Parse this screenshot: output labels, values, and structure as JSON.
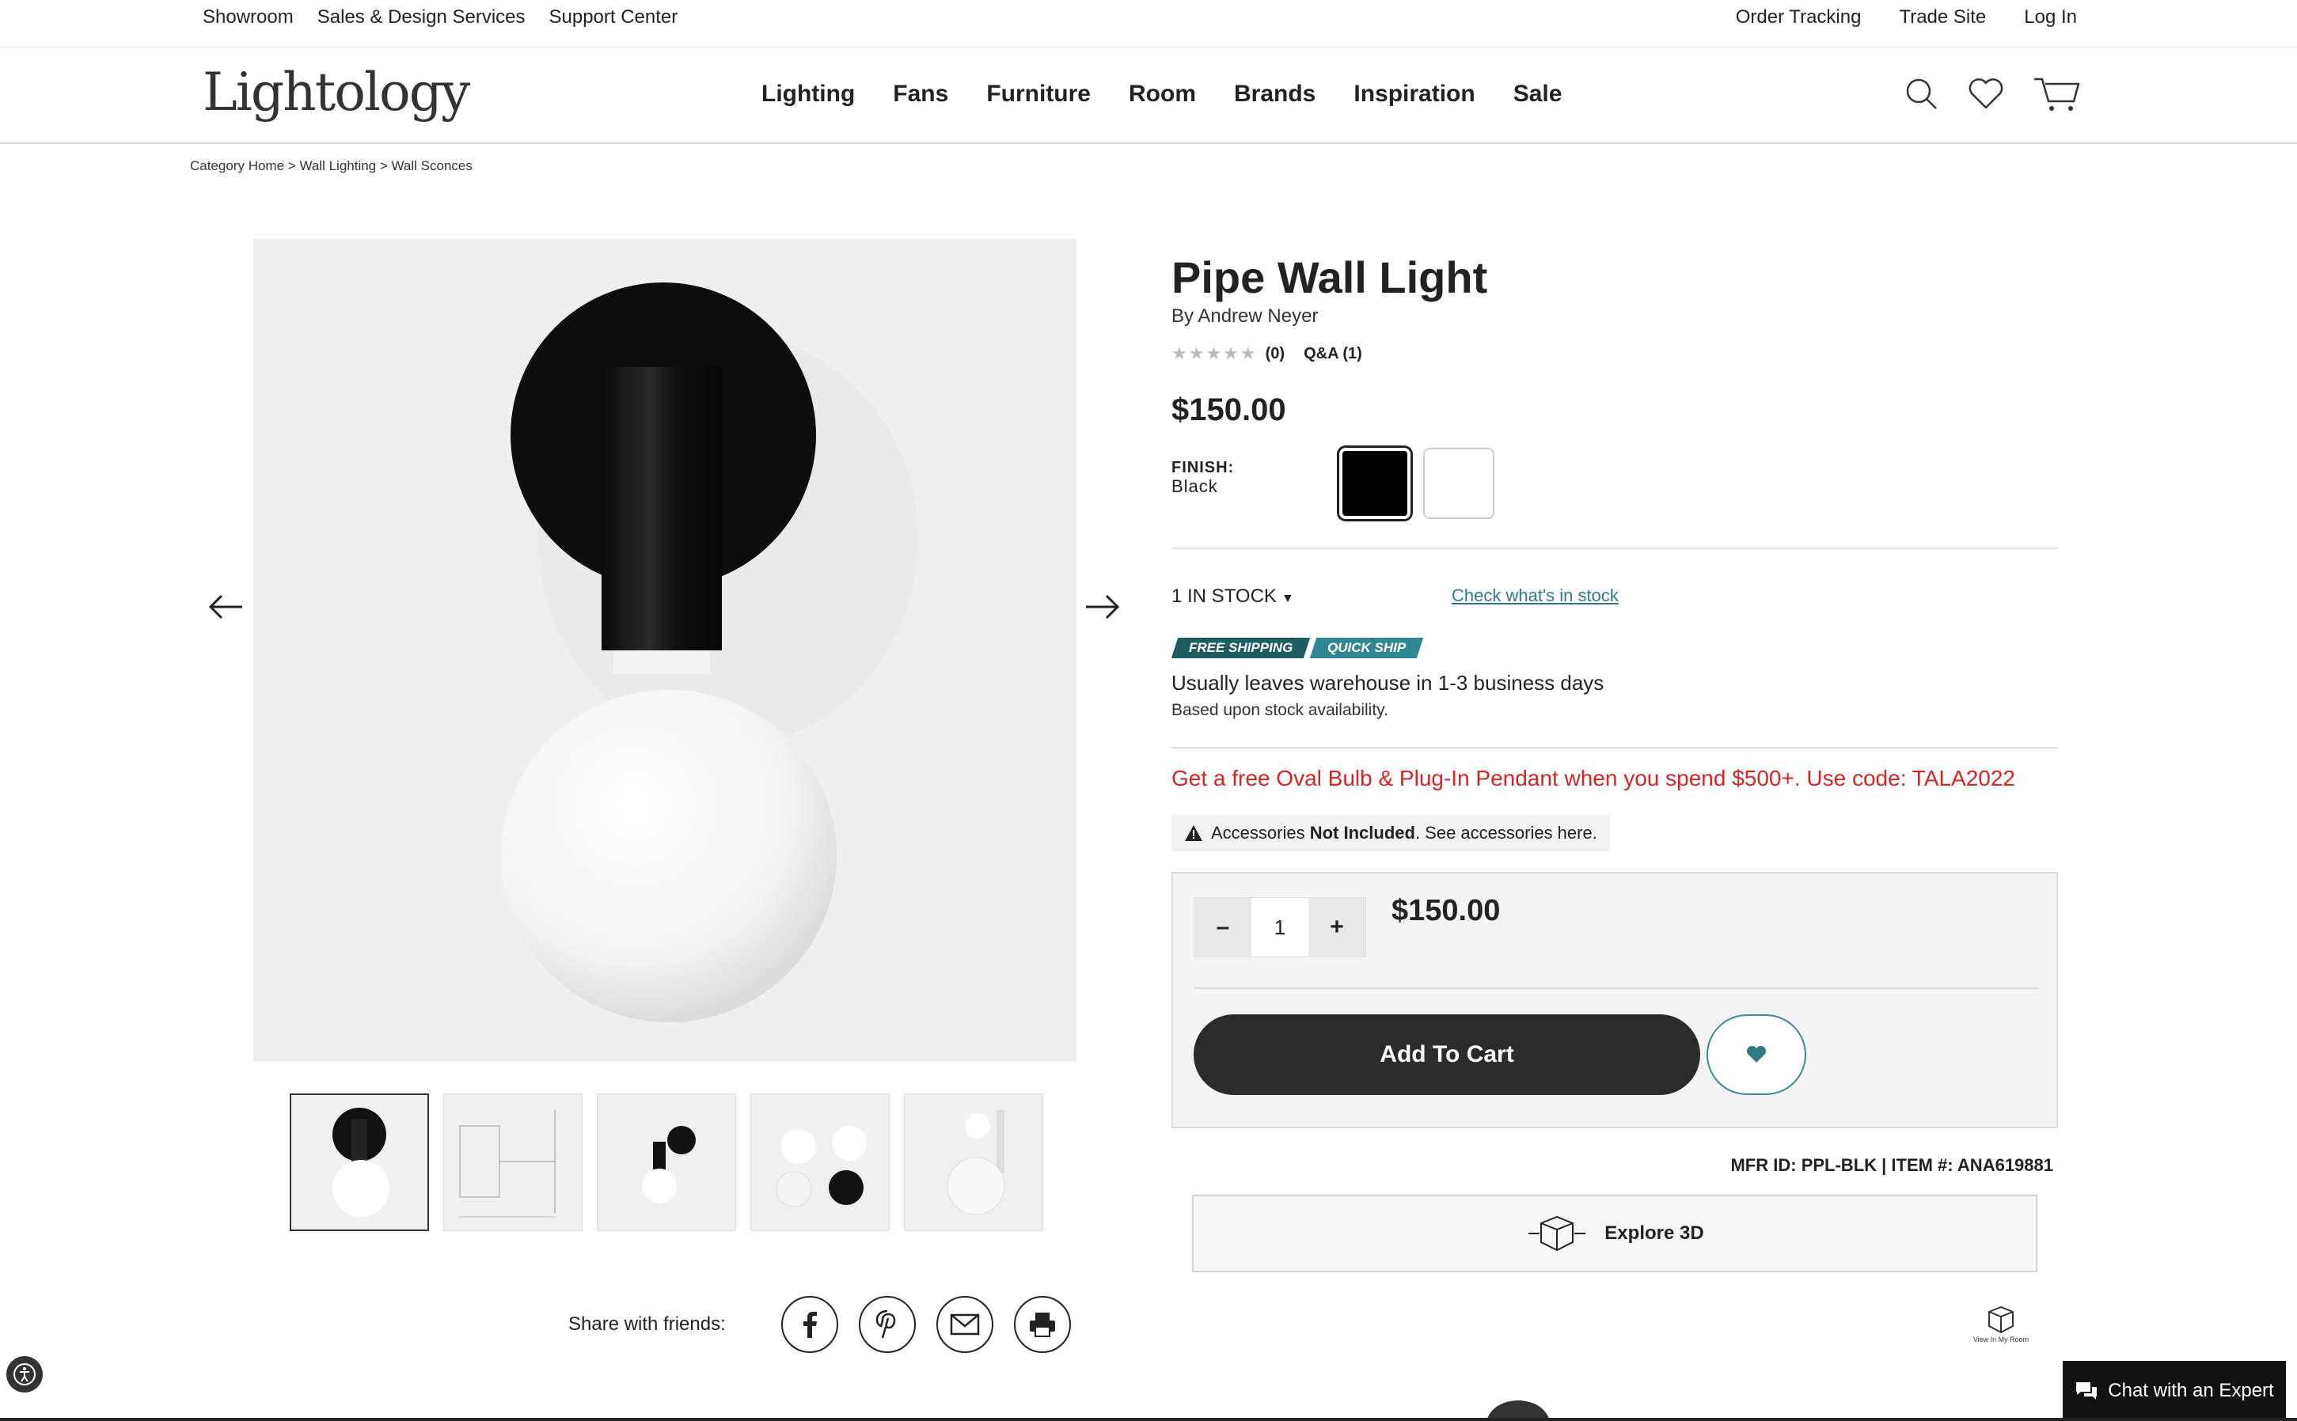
{
  "topbar": {
    "left": [
      "Showroom",
      "Sales & Design Services",
      "Support Center"
    ],
    "right": [
      "Order Tracking",
      "Trade Site",
      "Log In"
    ]
  },
  "header": {
    "logo": "Lightology",
    "nav": [
      "Lighting",
      "Fans",
      "Furniture",
      "Room",
      "Brands",
      "Inspiration",
      "Sale"
    ],
    "icons": [
      "search-icon",
      "heart-icon",
      "cart-icon"
    ]
  },
  "breadcrumb": [
    "Category Home",
    "Wall Lighting",
    "Wall Sconces"
  ],
  "breadcrumb_sep": " > ",
  "product": {
    "title": "Pipe Wall Light",
    "brand": "By Andrew Neyer",
    "rating_stars": "★★★★★",
    "rating_count": "(0)",
    "qa": "Q&A (1)",
    "price": "$150.00",
    "finish_label": "FINISH:",
    "finish_value": "Black",
    "finish_options": [
      "Black",
      "White"
    ],
    "stock": "1 IN STOCK",
    "check_stock": "Check what's in stock",
    "badges": [
      "FREE SHIPPING",
      "QUICK SHIP"
    ],
    "ships": "Usually leaves warehouse in 1-3 business days",
    "ships_sub": "Based upon stock availability.",
    "promo": "Get a free Oval Bulb & Plug-In Pendant when you spend $500+. Use code: TALA2022",
    "accessories_pre": "Accessories ",
    "accessories_bold": "Not Included",
    "accessories_post": ". See accessories here.",
    "quantity": "1",
    "minus": "–",
    "plus": "+",
    "cart_price": "$150.00",
    "add_to_cart": "Add To Cart",
    "mfr": "MFR ID: PPL-BLK | ITEM #: ANA619881",
    "explore": "Explore 3D",
    "view_room": "View In My Room"
  },
  "share": {
    "label": "Share with friends:",
    "icons": [
      "facebook-icon",
      "pinterest-icon",
      "email-icon",
      "print-icon"
    ]
  },
  "chat": "Chat with an Expert",
  "colors": {
    "accent": "#2f7a85",
    "promo": "#d02626",
    "badge_dark": "#1f5d63",
    "badge_light": "#2f8794"
  }
}
